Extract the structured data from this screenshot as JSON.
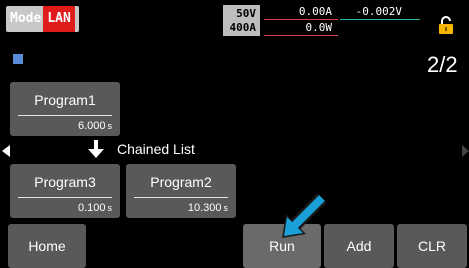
{
  "status_bar": {
    "mode_label": "Mode",
    "interface_label": "LAN",
    "voltage_range": "50V",
    "current_range": "400A",
    "current_reading": "0.00A",
    "power_reading": "0.0W",
    "voltage_reading": "-0.002V"
  },
  "page_indicator": "2/2",
  "programs": [
    {
      "name": "Program1",
      "time": "6.000",
      "unit": "s"
    },
    {
      "name": "Program3",
      "time": "0.100",
      "unit": "s"
    },
    {
      "name": "Program2",
      "time": "10.300",
      "unit": "s"
    }
  ],
  "chain_label": "Chained List",
  "buttons": {
    "home": "Home",
    "run": "Run",
    "add": "Add",
    "clr": "CLR"
  },
  "colors": {
    "lan_badge": "#e01b1b",
    "button_bg": "#595959",
    "lock_icon": "#f5b400",
    "cursor": "#1aa0d8"
  }
}
